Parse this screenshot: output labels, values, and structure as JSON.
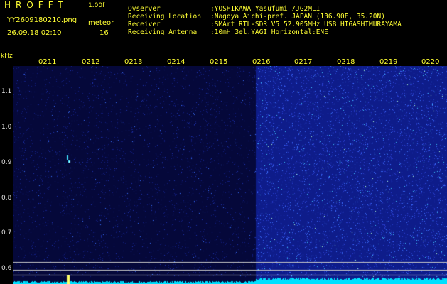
{
  "header": {
    "app_title": "HROFFT",
    "version": "1.00f",
    "file_name": "YY2609180210.png",
    "meteor_label": "meteor",
    "meteor_count": "16",
    "datetime": "26.09.18 02:10"
  },
  "info": [
    {
      "key": "Ovserver",
      "value": ":YOSHIKAWA Yasufumi /JG2MLI"
    },
    {
      "key": "Receiving Location",
      "value": ":Nagoya Aichi-pref. JAPAN (136.90E, 35.20N)"
    },
    {
      "key": "Receiver",
      "value": ":SMArt RTL-SDR V5 52.905MHz USB HIGASHIMURAYAMA"
    },
    {
      "key": "Receiving Antenna",
      "value": ":10mH 3el.YAGI Horizontal:ENE"
    }
  ],
  "axis": {
    "unit": "kHz",
    "time_labels": [
      "0211",
      "0212",
      "0213",
      "0214",
      "0215",
      "0216",
      "0217",
      "0218",
      "0219",
      "0220"
    ],
    "freq_labels": [
      "1.1",
      "1.0",
      "0.9",
      "0.8",
      "0.7",
      "0.6"
    ]
  },
  "colors": {
    "background": "#000000",
    "text": "#ffff33",
    "spectrum_dark": "#0a0f4a",
    "spectrum_bright": "#1a2a9a",
    "baseline": "#00e0ff"
  }
}
